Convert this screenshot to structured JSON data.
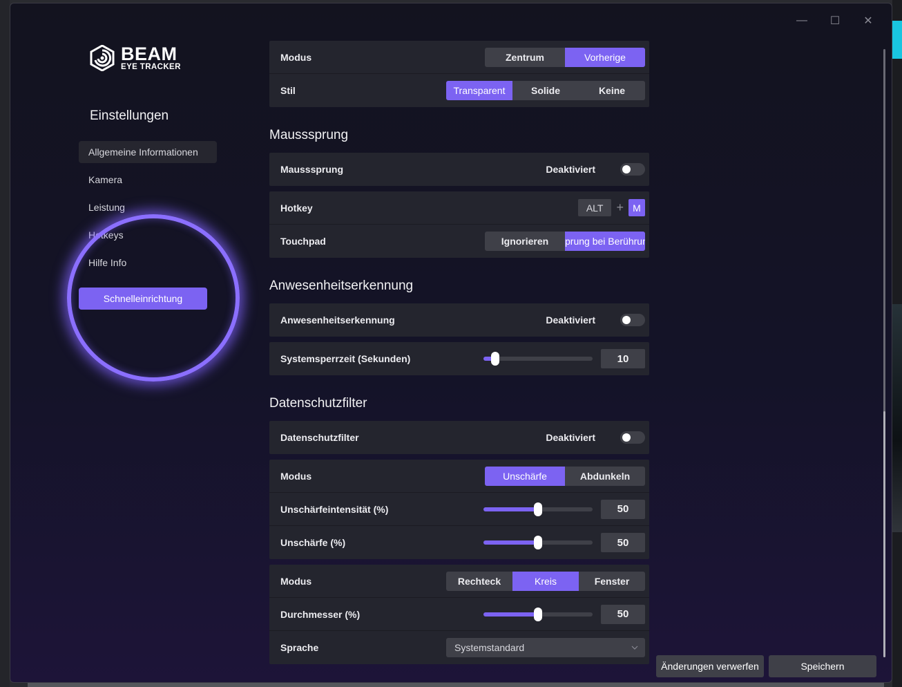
{
  "window": {
    "minimize_label": "—",
    "maximize_label": "☐",
    "close_label": "✕"
  },
  "logo": {
    "main": "BEAM",
    "sub": "EYE TRACKER"
  },
  "sidebar": {
    "title": "Einstellungen",
    "items": [
      {
        "label": "Allgemeine Informationen",
        "active": true
      },
      {
        "label": "Kamera"
      },
      {
        "label": "Leistung"
      },
      {
        "label": "Hotkeys"
      },
      {
        "label": "Hilfe  Info"
      }
    ],
    "quick_setup_label": "Schnelleinrichtung"
  },
  "top_card": {
    "modus": {
      "label": "Modus",
      "options": [
        "Zentrum",
        "Vorherige"
      ],
      "selected": "Vorherige"
    },
    "stil": {
      "label": "Stil",
      "options": [
        "Transparent",
        "Solide",
        "Keine"
      ],
      "selected": "Transparent"
    }
  },
  "mausssprung_section": {
    "title": "Mausssprung",
    "toggle": {
      "label": "Mausssprung",
      "state": "Deaktiviert"
    },
    "hotkey": {
      "label": "Hotkey",
      "keys": [
        "ALT",
        "M"
      ],
      "plus": "+"
    },
    "touchpad": {
      "label": "Touchpad",
      "options": [
        "Ignorieren",
        "prung bei Berührun"
      ],
      "selected": "prung bei Berührun"
    }
  },
  "presence_section": {
    "title": "Anwesenheitserkennung",
    "toggle": {
      "label": "Anwesenheitserkennung",
      "state": "Deaktiviert"
    },
    "lock_time": {
      "label": "Systemsperrzeit (Sekunden)",
      "value": "10",
      "level": 0.11
    }
  },
  "privacy_section": {
    "title": "Datenschutzfilter",
    "toggle": {
      "label": "Datenschutzfilter",
      "state": "Deaktiviert"
    },
    "modus": {
      "label": "Modus",
      "options": [
        "Unschärfe",
        "Abdunkeln"
      ],
      "selected": "Unschärfe"
    },
    "blur_intensity": {
      "label": "Unschärfeintensität (%)",
      "value": "50",
      "level": 0.5
    },
    "blur": {
      "label": "Unschärfe (%)",
      "value": "50",
      "level": 0.5
    },
    "shape_modus": {
      "label": "Modus",
      "options": [
        "Rechteck",
        "Kreis",
        "Fenster"
      ],
      "selected": "Kreis"
    },
    "diameter": {
      "label": "Durchmesser (%)",
      "value": "50",
      "level": 0.5
    },
    "language": {
      "label": "Sprache",
      "value": "Systemstandard"
    }
  },
  "footer": {
    "discard_label": "Änderungen verwerfen",
    "save_label": "Speichern"
  },
  "colors": {
    "accent": "#7c63f2",
    "card": "#24252e",
    "control": "#3f4048"
  }
}
